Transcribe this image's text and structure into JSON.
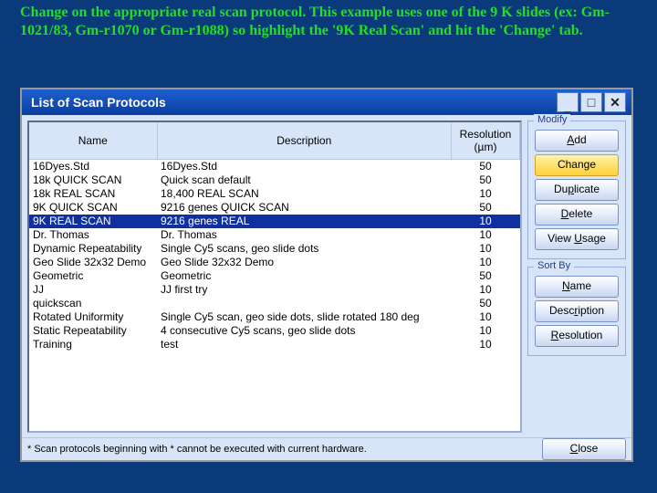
{
  "instruction": "Change on the appropriate real scan protocol. This example uses one of the 9 K slides (ex: Gm-1021/83, Gm-r1070 or Gm-r1088) so highlight the '9K Real Scan' and hit the 'Change' tab.",
  "window": {
    "title": "List of Scan Protocols",
    "columns": {
      "name": "Name",
      "desc": "Description",
      "res": "Resolution (µm)"
    },
    "rows": [
      {
        "name": "16Dyes.Std",
        "desc": "16Dyes.Std",
        "res": "50",
        "selected": false
      },
      {
        "name": "18k QUICK SCAN",
        "desc": "Quick scan default",
        "res": "50",
        "selected": false
      },
      {
        "name": "18k REAL SCAN",
        "desc": "18,400 REAL SCAN",
        "res": "10",
        "selected": false
      },
      {
        "name": "9K QUICK SCAN",
        "desc": "9216 genes QUICK SCAN",
        "res": "50",
        "selected": false
      },
      {
        "name": "9K REAL SCAN",
        "desc": "9216 genes REAL",
        "res": "10",
        "selected": true
      },
      {
        "name": "Dr. Thomas",
        "desc": "Dr. Thomas",
        "res": "10",
        "selected": false
      },
      {
        "name": "Dynamic Repeatability",
        "desc": "Single Cy5 scans, geo slide dots",
        "res": "10",
        "selected": false
      },
      {
        "name": "Geo Slide 32x32 Demo",
        "desc": "Geo Slide 32x32 Demo",
        "res": "10",
        "selected": false
      },
      {
        "name": "Geometric",
        "desc": "Geometric",
        "res": "50",
        "selected": false
      },
      {
        "name": "JJ",
        "desc": "JJ first try",
        "res": "10",
        "selected": false
      },
      {
        "name": "quickscan",
        "desc": "",
        "res": "50",
        "selected": false
      },
      {
        "name": "Rotated Uniformity",
        "desc": "Single Cy5 scan, geo side dots, slide rotated 180 deg",
        "res": "10",
        "selected": false
      },
      {
        "name": "Static Repeatability",
        "desc": "4 consecutive Cy5 scans, geo slide dots",
        "res": "10",
        "selected": false
      },
      {
        "name": "Training",
        "desc": "test",
        "res": "10",
        "selected": false
      }
    ],
    "modify": {
      "title": "Modify",
      "add": "Add",
      "add_u": "A",
      "change": "Chan",
      "change_u": "g",
      "change_suffix": "e",
      "duplicate": "Du",
      "duplicate_u": "p",
      "duplicate_suffix": "licate",
      "delete": "Delete",
      "delete_u": "D",
      "delete_rest": "elete",
      "usage": "View ",
      "usage_u": "U",
      "usage_suffix": "sage"
    },
    "sort": {
      "title": "Sort By",
      "name": "Name",
      "name_u": "N",
      "name_rest": "ame",
      "desc": "Desc",
      "desc_u": "r",
      "desc_suffix": "iption",
      "res": "",
      "res_u": "R",
      "res_suffix": "esolution"
    },
    "footer_note": "* Scan protocols beginning with * cannot be executed with current hardware.",
    "close": "",
    "close_u": "C",
    "close_suffix": "lose"
  }
}
